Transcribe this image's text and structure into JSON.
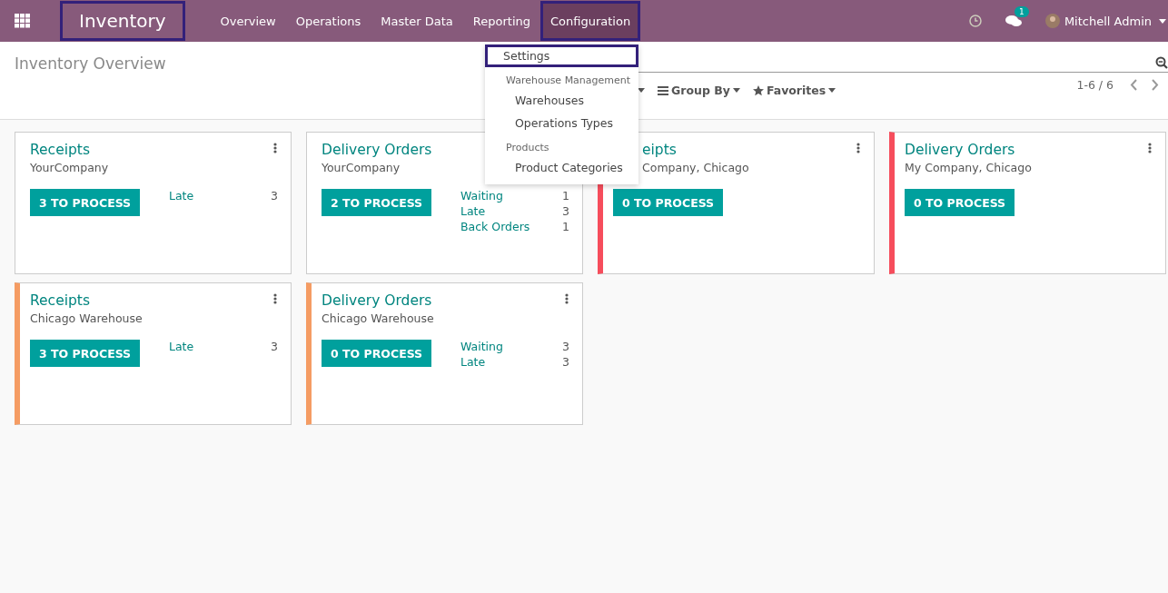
{
  "navbar": {
    "app_name": "Inventory",
    "app_name_highlighted": true,
    "menu": [
      {
        "label": "Overview",
        "selected": false,
        "highlighted": false
      },
      {
        "label": "Operations",
        "selected": false,
        "highlighted": false
      },
      {
        "label": "Master Data",
        "selected": false,
        "highlighted": false
      },
      {
        "label": "Reporting",
        "selected": false,
        "highlighted": false
      },
      {
        "label": "Configuration",
        "selected": true,
        "highlighted": true
      }
    ],
    "messages_badge": "1",
    "user": "Mitchell Admin"
  },
  "dropdown": {
    "items": [
      {
        "kind": "item",
        "label": "Settings",
        "highlighted": true
      },
      {
        "kind": "header",
        "label": "Warehouse Management"
      },
      {
        "kind": "item",
        "label": "Warehouses",
        "highlighted": false
      },
      {
        "kind": "item",
        "label": "Operations Types",
        "highlighted": false
      },
      {
        "kind": "header",
        "label": "Products"
      },
      {
        "kind": "item",
        "label": "Product Categories",
        "highlighted": false
      }
    ]
  },
  "control_panel": {
    "title": "Inventory Overview",
    "filters": [
      {
        "label": "Group By"
      },
      {
        "label": "Favorites"
      }
    ],
    "pager": "1-6 / 6"
  },
  "cards": [
    {
      "title": "Receipts",
      "subtitle": "YourCompany",
      "button": "3 TO PROCESS",
      "color": "#ffffff",
      "covered": false,
      "stats": [
        {
          "label": "Late",
          "value": "3"
        }
      ]
    },
    {
      "title": "Delivery Orders",
      "subtitle": "YourCompany",
      "button": "2 TO PROCESS",
      "color": "#ffffff",
      "covered": false,
      "stats": [
        {
          "label": "Waiting",
          "value": "1"
        },
        {
          "label": "Late",
          "value": "3"
        },
        {
          "label": "Back Orders",
          "value": "1"
        }
      ]
    },
    {
      "title": "eipts",
      "subtitle": "Company, Chicago",
      "button": "0 TO PROCESS",
      "color": "#f64d5c",
      "covered": true
    },
    {
      "title": "Delivery Orders",
      "subtitle": "My Company, Chicago",
      "button": "0 TO PROCESS",
      "color": "#f64d5c",
      "covered": false
    },
    {
      "title": "Receipts",
      "subtitle": "Chicago Warehouse",
      "button": "3 TO PROCESS",
      "color": "#f59c63",
      "covered": false,
      "stats": [
        {
          "label": "Late",
          "value": "3"
        }
      ]
    },
    {
      "title": "Delivery Orders",
      "subtitle": "Chicago Warehouse",
      "button": "0 TO PROCESS",
      "color": "#f59c63",
      "covered": false,
      "stats": [
        {
          "label": "Waiting",
          "value": "3"
        },
        {
          "label": "Late",
          "value": "3"
        }
      ]
    }
  ]
}
